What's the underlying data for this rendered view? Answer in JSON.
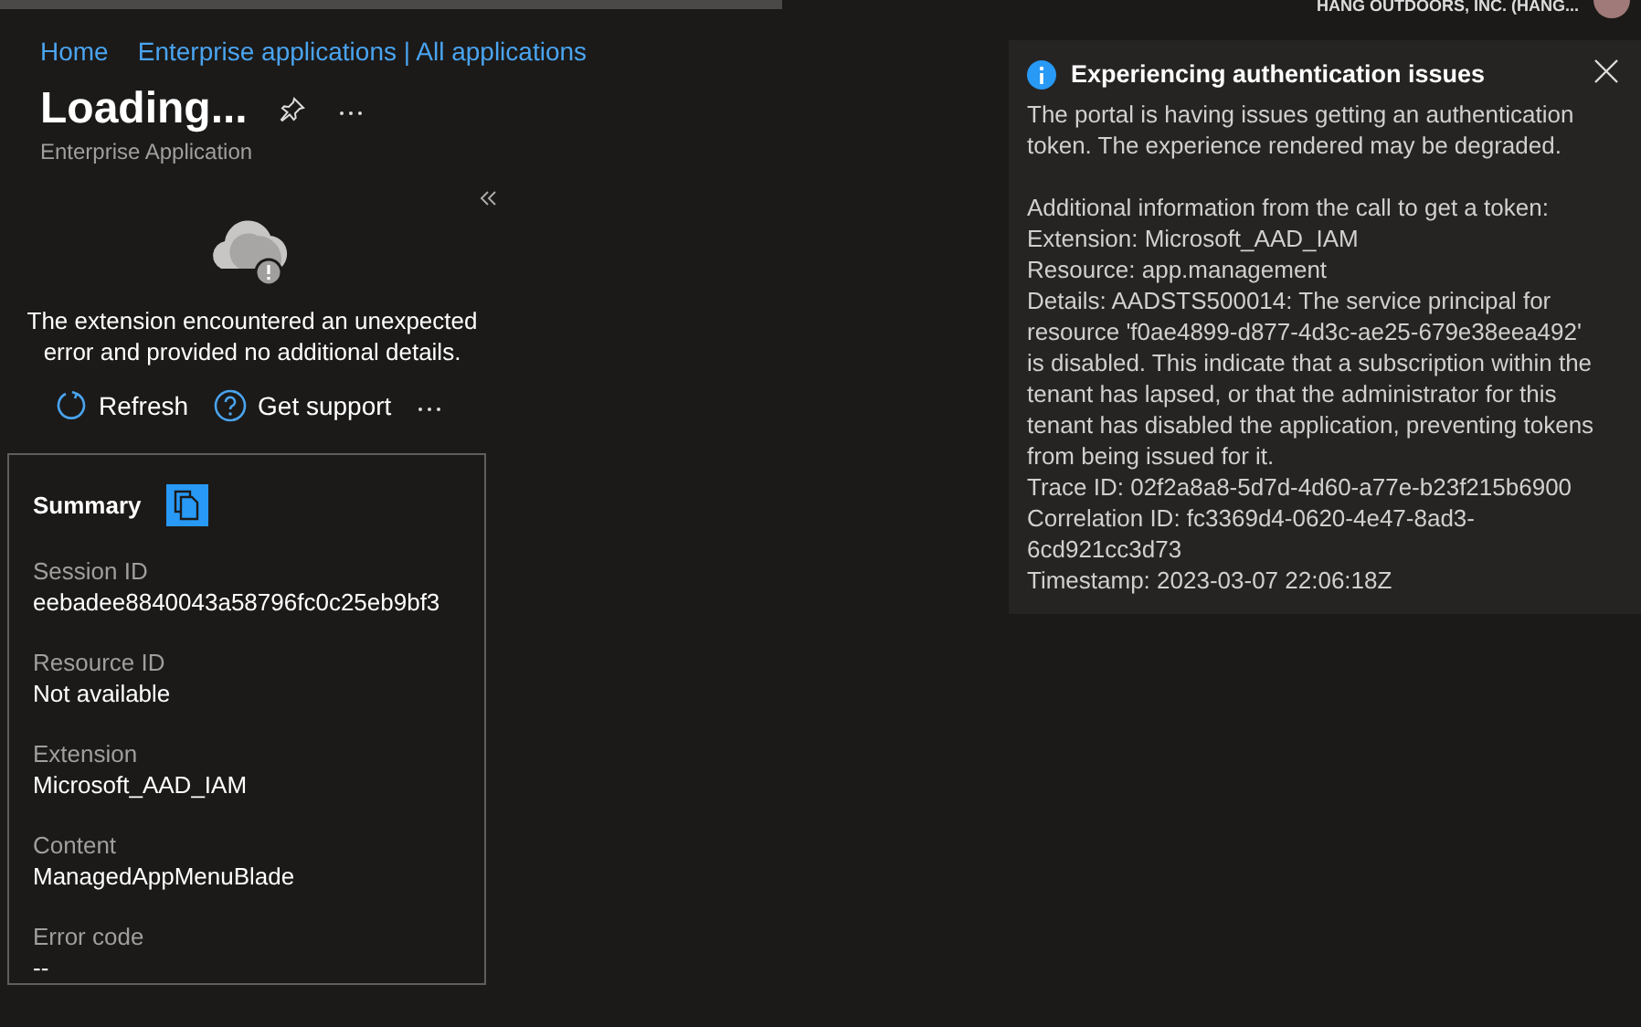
{
  "top_bar": {
    "account": "HANG OUTDOORS, INC. (HANG..."
  },
  "breadcrumb": [
    "Home",
    "Enterprise applications | All applications"
  ],
  "header": {
    "title": "Loading...",
    "subtitle": "Enterprise Application"
  },
  "error": {
    "message": "The extension encountered an unexpected error and provided no additional details.",
    "actions": [
      {
        "kind": "refresh",
        "label": "Refresh"
      },
      {
        "kind": "support",
        "label": "Get support"
      }
    ]
  },
  "summary": {
    "title": "Summary",
    "fields": [
      {
        "label": "Session ID",
        "value": "eebadee8840043a58796fc0c25eb9bf3"
      },
      {
        "label": "Resource ID",
        "value": "Not available"
      },
      {
        "label": "Extension",
        "value": "Microsoft_AAD_IAM"
      },
      {
        "label": "Content",
        "value": "ManagedAppMenuBlade"
      },
      {
        "label": "Error code",
        "value": "--"
      }
    ]
  },
  "notification": {
    "title": "Experiencing authentication issues",
    "intro": "The portal is having issues getting an authentication token. The experience rendered may be degraded.",
    "details": [
      "Additional information from the call to get a token:",
      "Extension: Microsoft_AAD_IAM",
      "Resource: app.management",
      "Details: AADSTS500014: The service principal for resource 'f0ae4899-d877-4d3c-ae25-679e38eea492' is disabled. This indicate that a subscription within the tenant has lapsed, or that the administrator for this tenant has disabled the application, preventing tokens from being issued for it.",
      "Trace ID: 02f2a8a8-5d7d-4d60-a77e-b23f215b6900",
      "Correlation ID: fc3369d4-0620-4e47-8ad3-6cd921cc3d73",
      "Timestamp: 2023-03-07 22:06:18Z"
    ]
  }
}
